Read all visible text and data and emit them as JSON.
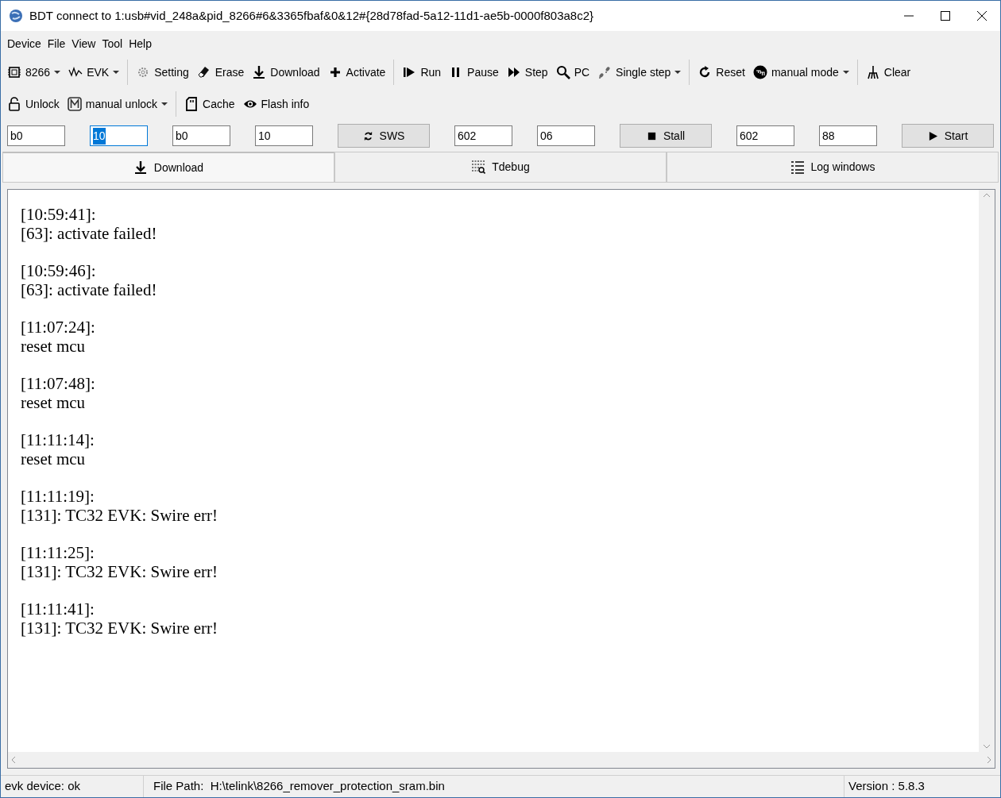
{
  "window": {
    "title": "BDT connect to 1:usb#vid_248a&pid_8266#6&3365fbaf&0&12#{28d78fad-5a12-11d1-ae5b-0000f803a8c2}"
  },
  "menu": [
    "Device",
    "File",
    "View",
    "Tool",
    "Help"
  ],
  "toolbar_1": [
    [
      {
        "label": "8266",
        "dropdown": true
      },
      {
        "label": "EVK",
        "dropdown": true
      }
    ],
    [
      {
        "label": "Setting",
        "dropdown": false
      },
      {
        "label": "Erase",
        "dropdown": false
      },
      {
        "label": "Download",
        "dropdown": false
      },
      {
        "label": "Activate",
        "dropdown": false
      }
    ],
    [
      {
        "label": "Run",
        "dropdown": false
      },
      {
        "label": "Pause",
        "dropdown": false
      },
      {
        "label": "Step",
        "dropdown": false
      },
      {
        "label": "PC",
        "dropdown": false
      },
      {
        "label": "Single step",
        "dropdown": true
      }
    ],
    [
      {
        "label": "Reset",
        "dropdown": false
      },
      {
        "label": "manual mode",
        "dropdown": true
      }
    ],
    [
      {
        "label": "Clear",
        "dropdown": false
      }
    ]
  ],
  "toolbar_2": [
    [
      {
        "label": "Unlock",
        "dropdown": false
      },
      {
        "label": "manual unlock",
        "dropdown": true
      }
    ],
    [
      {
        "label": "Cache",
        "dropdown": false
      },
      {
        "label": "Flash info",
        "dropdown": false
      }
    ]
  ],
  "register_row": [
    {
      "kind": "field",
      "value": "b0",
      "focused": false
    },
    {
      "kind": "field",
      "value": "10",
      "focused": true
    },
    {
      "kind": "field",
      "value": "b0",
      "focused": false
    },
    {
      "kind": "field",
      "value": "10",
      "focused": false
    },
    {
      "kind": "button",
      "label": "SWS"
    },
    {
      "kind": "field",
      "value": "602",
      "focused": false
    },
    {
      "kind": "field",
      "value": "06",
      "focused": false
    },
    {
      "kind": "button",
      "label": "Stall"
    },
    {
      "kind": "field",
      "value": "602",
      "focused": false
    },
    {
      "kind": "field",
      "value": "88",
      "focused": false
    },
    {
      "kind": "button",
      "label": "Start"
    }
  ],
  "tabs": [
    {
      "label": "Download",
      "selected": true
    },
    {
      "label": "Tdebug",
      "selected": false
    },
    {
      "label": "Log windows",
      "selected": false
    }
  ],
  "log": [
    {
      "time": "[10:59:41]:",
      "message": "[63]: activate failed!"
    },
    {
      "time": "[10:59:46]:",
      "message": "[63]: activate failed!"
    },
    {
      "time": "[11:07:24]:",
      "message": "reset mcu"
    },
    {
      "time": "[11:07:48]:",
      "message": "reset mcu"
    },
    {
      "time": "[11:11:14]:",
      "message": "reset mcu"
    },
    {
      "time": "[11:11:19]:",
      "message": "[131]: TC32 EVK: Swire err!"
    },
    {
      "time": "[11:11:25]:",
      "message": "[131]: TC32 EVK: Swire err!"
    },
    {
      "time": "[11:11:41]:",
      "message": "[131]: TC32 EVK: Swire err!"
    }
  ],
  "status_bar": {
    "device": "evk device: ok",
    "file_path": "File Path:  H:\\telink\\8266_remover_protection_sram.bin",
    "version": "Version : 5.8.3"
  }
}
